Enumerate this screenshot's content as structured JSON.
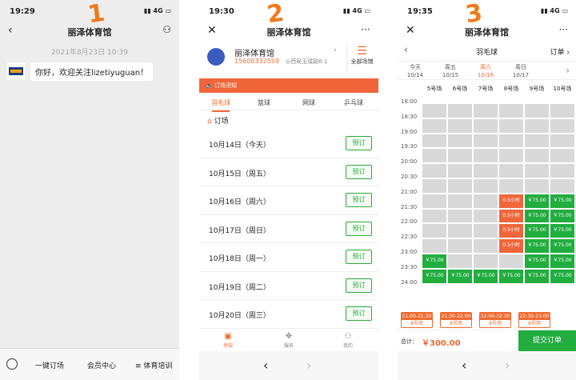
{
  "annotations": [
    "1",
    "2",
    "3"
  ],
  "screen1": {
    "time": "19:29",
    "signal": "4G",
    "title": "丽泽体育馆",
    "date_stamp": "2021年8月23日 10:39",
    "message": "你好，欢迎关注lizetiyuguan！",
    "menu": [
      "一键订场",
      "会员中心",
      "≡ 体育培训"
    ]
  },
  "screen2": {
    "time": "19:30",
    "signal": "4G",
    "title": "丽泽体育馆",
    "more": "···",
    "venue_name": "丽泽体育馆",
    "venue_phone": "15600332559",
    "venue_addr": "◎西局玉璞路6-1",
    "all_venues": "全部场馆",
    "notice": "订场须知",
    "sports": [
      "羽毛球",
      "篮球",
      "网球",
      "乒乓球"
    ],
    "section_title": "订场",
    "dates": [
      {
        "label": "10月14日（今天）",
        "btn": "预订"
      },
      {
        "label": "10月15日（周五）",
        "btn": "预订"
      },
      {
        "label": "10月16日（周六）",
        "btn": "预订"
      },
      {
        "label": "10月17日（周日）",
        "btn": "预订"
      },
      {
        "label": "10月18日（周一）",
        "btn": "预订"
      },
      {
        "label": "10月19日（周二）",
        "btn": "预订"
      },
      {
        "label": "10月20日（周三）",
        "btn": "预订"
      }
    ],
    "tabbar": [
      "场馆",
      "服务",
      "我的"
    ]
  },
  "screen3": {
    "time": "19:35",
    "signal": "4G",
    "title": "丽泽体育馆",
    "more": "···",
    "sport": "羽毛球",
    "orders": "订单",
    "days": [
      {
        "w": "今天",
        "d": "10/14"
      },
      {
        "w": "周五",
        "d": "10/15"
      },
      {
        "w": "周六",
        "d": "10/16"
      },
      {
        "w": "周日",
        "d": "10/17"
      }
    ],
    "courts": [
      "5号场",
      "6号场",
      "7号场",
      "8号场",
      "9号场",
      "10号场"
    ],
    "times": [
      "18:00",
      "18:30",
      "19:00",
      "19:30",
      "20:00",
      "20:30",
      "21:00",
      "21:30",
      "22:00",
      "22:30",
      "23:00",
      "23:30",
      "24:00"
    ],
    "price": "￥75.00",
    "half_hour": "0.5小时",
    "picked": [
      {
        "t": "21:00-21:30",
        "c": "8号场"
      },
      {
        "t": "21:30-22:00",
        "c": "8号场"
      },
      {
        "t": "22:00-22:30",
        "c": "8号场"
      },
      {
        "t": "22:30-23:00",
        "c": "8号场"
      }
    ],
    "total_label": "总计：",
    "total": "￥300.00",
    "submit": "提交订单",
    "colors": {
      "free": "#22ad3f",
      "selected": "#f0663a",
      "unavailable": "#d9d9d9"
    }
  }
}
